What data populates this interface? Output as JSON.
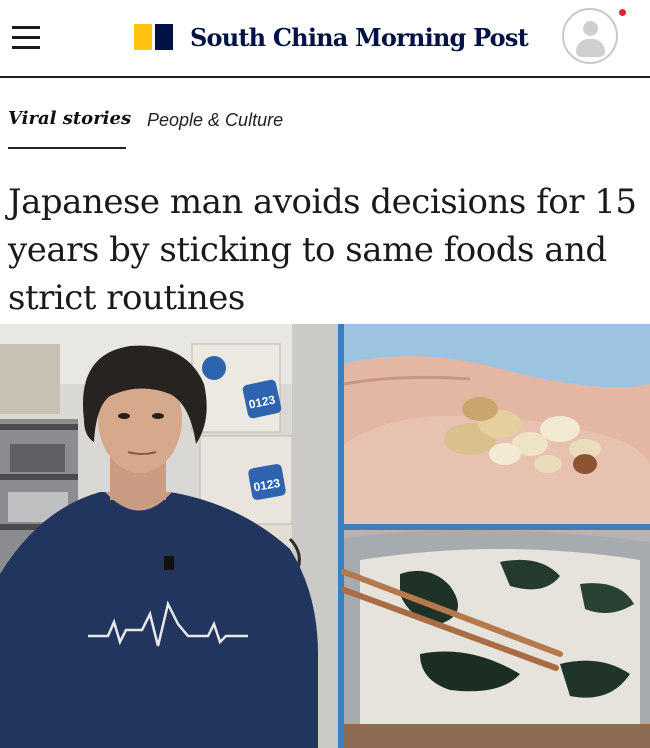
{
  "header": {
    "menu_icon": "hamburger-menu-icon",
    "brand_name": "South China Morning Post",
    "brand_colors": {
      "yellow": "#ffc20e",
      "navy": "#001246"
    },
    "account_icon": "user-avatar-icon",
    "notification_color": "#e2232d"
  },
  "article": {
    "section_primary": "Viral stories",
    "section_secondary": "People & Culture",
    "headline": "Japanese man avoids decisions for 15 years by sticking to same foods and strict routines",
    "lead_image": {
      "panels": [
        "man-in-blue-tshirt-photo",
        "hand-holding-nuts-photo",
        "rice-with-seaweed-and-chopsticks-photo"
      ],
      "box_labels": [
        "0123",
        "0123"
      ]
    }
  }
}
